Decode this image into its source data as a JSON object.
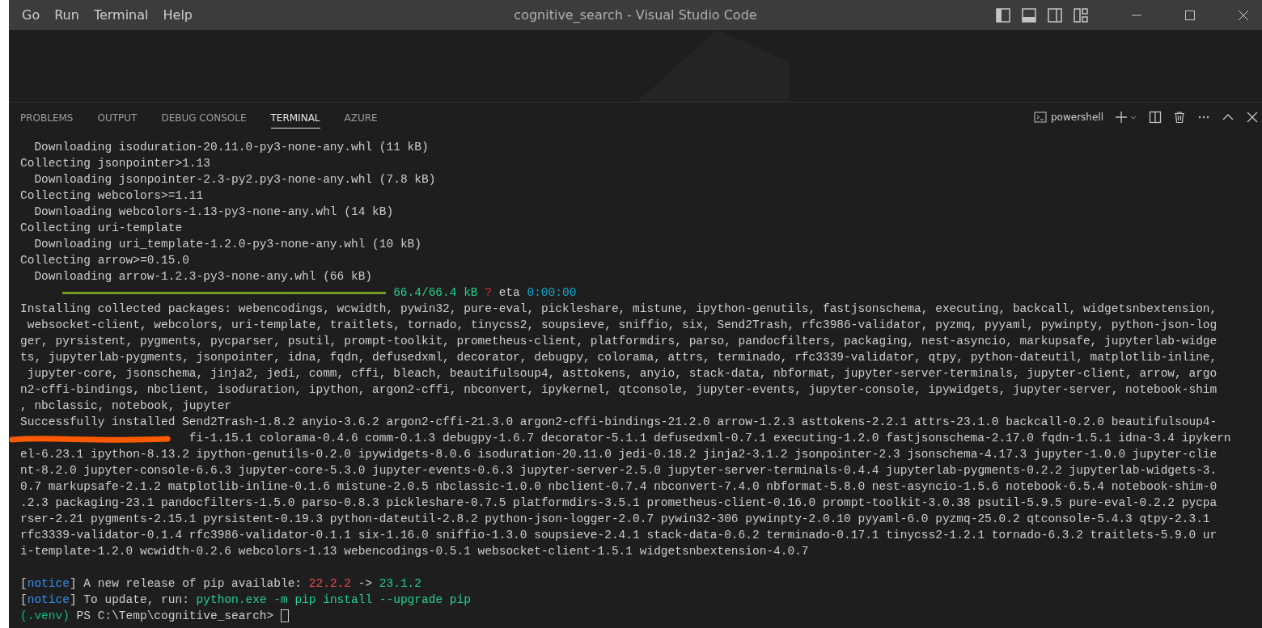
{
  "menu": [
    "Go",
    "Run",
    "Terminal",
    "Help"
  ],
  "window": {
    "title": "cognitive_search - Visual Studio Code"
  },
  "panel": {
    "tabs": [
      {
        "label": "PROBLEMS",
        "selected": false
      },
      {
        "label": "OUTPUT",
        "selected": false
      },
      {
        "label": "DEBUG CONSOLE",
        "selected": false
      },
      {
        "label": "TERMINAL",
        "selected": true
      },
      {
        "label": "AZURE",
        "selected": false
      }
    ],
    "terminal_name": "powershell"
  },
  "terminal": {
    "lines": [
      {
        "kind": "text",
        "segments": [
          {
            "kind": "plain",
            "text": "  Downloading isoduration-20.11.0-py3-none-any.whl (11 kB)"
          }
        ]
      },
      {
        "kind": "text",
        "segments": [
          {
            "kind": "plain",
            "text": "Collecting jsonpointer>1.13"
          }
        ]
      },
      {
        "kind": "text",
        "segments": [
          {
            "kind": "plain",
            "text": "  Downloading jsonpointer-2.3-py2.py3-none-any.whl (7.8 kB)"
          }
        ]
      },
      {
        "kind": "text",
        "segments": [
          {
            "kind": "plain",
            "text": "Collecting webcolors>=1.11"
          }
        ]
      },
      {
        "kind": "text",
        "segments": [
          {
            "kind": "plain",
            "text": "  Downloading webcolors-1.13-py3-none-any.whl (14 kB)"
          }
        ]
      },
      {
        "kind": "text",
        "segments": [
          {
            "kind": "plain",
            "text": "Collecting uri-template"
          }
        ]
      },
      {
        "kind": "text",
        "segments": [
          {
            "kind": "plain",
            "text": "  Downloading uri_template-1.2.0-py3-none-any.whl (10 kB)"
          }
        ]
      },
      {
        "kind": "text",
        "segments": [
          {
            "kind": "plain",
            "text": "Collecting arrow>=0.15.0"
          }
        ]
      },
      {
        "kind": "text",
        "segments": [
          {
            "kind": "plain",
            "text": "  Downloading arrow-1.2.3-py3-none-any.whl (66 kB)"
          }
        ]
      },
      {
        "kind": "progress",
        "level": 1,
        "segments": [
          {
            "kind": "success",
            "text": "66.4/66.4 kB"
          },
          {
            "kind": "error",
            "text": "?"
          },
          {
            "kind": "plain",
            "text": "eta"
          },
          {
            "kind": "info",
            "text": "0:00:00"
          }
        ]
      },
      {
        "kind": "text",
        "segments": [
          {
            "kind": "plain",
            "text": "Installing collected packages: webencodings, wcwidth, pywin32, pure-eval, pickleshare, mistune, ipython-genutils, fastjsonschema, executing, backcall, widgetsnbextension,"
          }
        ]
      },
      {
        "kind": "text",
        "segments": [
          {
            "kind": "plain",
            "text": " websocket-client, webcolors, uri-template, traitlets, tornado, tinycss2, soupsieve, sniffio, six, Send2Trash, rfc3986-validator, pyzmq, pyyaml, pywinpty, python-json-log"
          }
        ]
      },
      {
        "kind": "text",
        "segments": [
          {
            "kind": "plain",
            "text": "ger, pyrsistent, pygments, pycparser, psutil, prompt-toolkit, prometheus-client, platformdirs, parso, pandocfilters, packaging, nest-asyncio, markupsafe, jupyterlab-widge"
          }
        ]
      },
      {
        "kind": "text",
        "segments": [
          {
            "kind": "plain",
            "text": "ts, jupyterlab-pygments, jsonpointer, idna, fqdn, defusedxml, decorator, debugpy, colorama, attrs, terminado, rfc3339-validator, qtpy, python-dateutil, matplotlib-inline,"
          }
        ]
      },
      {
        "kind": "text",
        "segments": [
          {
            "kind": "plain",
            "text": " jupyter-core, jsonschema, jinja2, jedi, comm, cffi, bleach, beautifulsoup4, asttokens, anyio, stack-data, nbformat, jupyter-server-terminals, jupyter-client, arrow, argo"
          }
        ]
      },
      {
        "kind": "text",
        "segments": [
          {
            "kind": "plain",
            "text": "n2-cffi-bindings, nbclient, isoduration, ipython, argon2-cffi, nbconvert, ipykernel, qtconsole, jupyter-events, jupyter-console, ipywidgets, jupyter-server, notebook-shim"
          }
        ]
      },
      {
        "kind": "text",
        "segments": [
          {
            "kind": "plain",
            "text": ", nbclassic, notebook, jupyter"
          }
        ]
      },
      {
        "kind": "text",
        "segments": [
          {
            "kind": "plain",
            "text": "Successfully installed Send2Trash-1.8.2 anyio-3.6.2 argon2-cffi-21.3.0 argon2-cffi-bindings-21.2.0 arrow-1.2.3 asttokens-2.2.1 attrs-23.1.0 backcall-0.2.0 beautifulsoup4-"
          }
        ]
      },
      {
        "kind": "redacted",
        "segments": [
          {
            "kind": "plain",
            "text": "fi-1.15.1 colorama-0.4.6 comm-0.1.3 debugpy-1.6.7 decorator-5.1.1 defusedxml-0.7.1 executing-1.2.0 fastjsonschema-2.17.0 fqdn-1.5.1 idna-3.4 ipykern"
          }
        ]
      },
      {
        "kind": "text",
        "segments": [
          {
            "kind": "plain",
            "text": "el-6.23.1 ipython-8.13.2 ipython-genutils-0.2.0 ipywidgets-8.0.6 isoduration-20.11.0 jedi-0.18.2 jinja2-3.1.2 jsonpointer-2.3 jsonschema-4.17.3 jupyter-1.0.0 jupyter-clie"
          }
        ]
      },
      {
        "kind": "text",
        "segments": [
          {
            "kind": "plain",
            "text": "nt-8.2.0 jupyter-console-6.6.3 jupyter-core-5.3.0 jupyter-events-0.6.3 jupyter-server-2.5.0 jupyter-server-terminals-0.4.4 jupyterlab-pygments-0.2.2 jupyterlab-widgets-3."
          }
        ]
      },
      {
        "kind": "text",
        "segments": [
          {
            "kind": "plain",
            "text": "0.7 markupsafe-2.1.2 matplotlib-inline-0.1.6 mistune-2.0.5 nbclassic-1.0.0 nbclient-0.7.4 nbconvert-7.4.0 nbformat-5.8.0 nest-asyncio-1.5.6 notebook-6.5.4 notebook-shim-0"
          }
        ]
      },
      {
        "kind": "text",
        "segments": [
          {
            "kind": "plain",
            "text": ".2.3 packaging-23.1 pandocfilters-1.5.0 parso-0.8.3 pickleshare-0.7.5 platformdirs-3.5.1 prometheus-client-0.16.0 prompt-toolkit-3.0.38 psutil-5.9.5 pure-eval-0.2.2 pycpa"
          }
        ]
      },
      {
        "kind": "text",
        "segments": [
          {
            "kind": "plain",
            "text": "rser-2.21 pygments-2.15.1 pyrsistent-0.19.3 python-dateutil-2.8.2 python-json-logger-2.0.7 pywin32-306 pywinpty-2.0.10 pyyaml-6.0 pyzmq-25.0.2 qtconsole-5.4.3 qtpy-2.3.1"
          }
        ]
      },
      {
        "kind": "text",
        "segments": [
          {
            "kind": "plain",
            "text": "rfc3339-validator-0.1.4 rfc3986-validator-0.1.1 six-1.16.0 sniffio-1.3.0 soupsieve-2.4.1 stack-data-0.6.2 terminado-0.17.1 tinycss2-1.2.1 tornado-6.3.2 traitlets-5.9.0 ur"
          }
        ]
      },
      {
        "kind": "text",
        "segments": [
          {
            "kind": "plain",
            "text": "i-template-1.2.0 wcwidth-0.2.6 webcolors-1.13 webencodings-0.5.1 websocket-client-1.5.1 widgetsnbextension-4.0.7"
          }
        ]
      },
      {
        "kind": "blank"
      },
      {
        "kind": "text",
        "segments": [
          {
            "kind": "plain",
            "text": "["
          },
          {
            "kind": "notice",
            "text": "notice"
          },
          {
            "kind": "plain",
            "text": "] A new release of pip available: "
          },
          {
            "kind": "old-version",
            "text": "22.2.2"
          },
          {
            "kind": "plain",
            "text": " -> "
          },
          {
            "kind": "success",
            "text": "23.1.2"
          }
        ]
      },
      {
        "kind": "text",
        "segments": [
          {
            "kind": "plain",
            "text": "["
          },
          {
            "kind": "notice",
            "text": "notice"
          },
          {
            "kind": "plain",
            "text": "] To update, run: "
          },
          {
            "kind": "success",
            "text": "python.exe -m pip install --upgrade pip"
          }
        ]
      },
      {
        "kind": "prompt",
        "segments": [
          {
            "kind": "venv",
            "text": "(.venv)"
          },
          {
            "kind": "plain",
            "text": " PS C:\\Temp\\cognitive_search> "
          }
        ]
      }
    ]
  }
}
